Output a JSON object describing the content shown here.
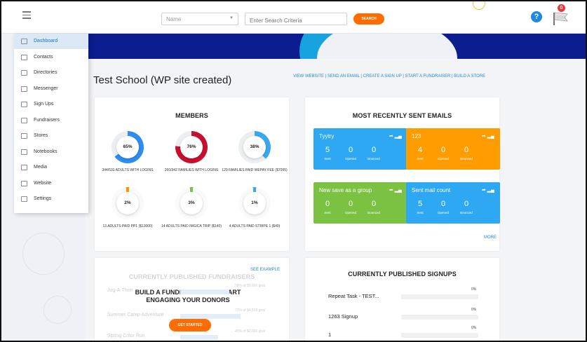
{
  "topbar": {
    "search_select_placeholder": "Name",
    "search_input_placeholder": "Enter Search Criteria",
    "search_button_label": "SEARCH",
    "help_icon_glyph": "?",
    "notification_count": "0"
  },
  "sidebar": {
    "items": [
      {
        "label": "Dashboard",
        "icon": "dashboard-icon"
      },
      {
        "label": "Contacts",
        "icon": "contacts-icon"
      },
      {
        "label": "Directories",
        "icon": "directories-icon"
      },
      {
        "label": "Messenger",
        "icon": "messenger-icon"
      },
      {
        "label": "Sign Ups",
        "icon": "sign-ups-icon"
      },
      {
        "label": "Fundraisers",
        "icon": "fundraisers-icon"
      },
      {
        "label": "Stores",
        "icon": "stores-icon"
      },
      {
        "label": "Notebooks",
        "icon": "notebooks-icon"
      },
      {
        "label": "Media",
        "icon": "media-icon"
      },
      {
        "label": "Website",
        "icon": "website-icon"
      },
      {
        "label": "Settings",
        "icon": "settings-icon"
      }
    ],
    "active_index": 0
  },
  "page": {
    "title": "Test School (WP site created)",
    "quick_links": [
      "VIEW WEBSITE",
      "SEND AN EMAIL",
      "CREATE A SIGN UP",
      "START A FUNDRAISER",
      "BUILD A STORE"
    ]
  },
  "members": {
    "title": "MEMBERS",
    "stats": [
      {
        "percent": "65%",
        "fraction": 0.65,
        "color": "#2f8cf0",
        "label": "344/531 ADULTS WITH LOGINS"
      },
      {
        "percent": "76%",
        "fraction": 0.76,
        "color": "#c8102e",
        "label": "260/342 FAMILIES WITH LOGINS"
      },
      {
        "percent": "38%",
        "fraction": 0.38,
        "color": "#3aa8f0",
        "label": "129 FAMILIES PAID WEPAY FEE ($7095)"
      },
      {
        "percent": "2%",
        "fraction": 0.02,
        "color": "#ff9800",
        "label": "13 ADULTS PAID PP1 ($13000)"
      },
      {
        "percent": "3%",
        "fraction": 0.03,
        "color": "#7cc242",
        "label": "14 ADULTS PAID IMGICA TRIP ($140)"
      },
      {
        "percent": "1%",
        "fraction": 0.01,
        "color": "#3aa8f0",
        "label": "4 ADULTS PAID STRIPE 1 ($40)"
      }
    ]
  },
  "emails": {
    "title": "MOST RECENTLY SENT EMAILS",
    "more_label": "MORE",
    "stat_labels": [
      "Sent",
      "Opened",
      "Bounced"
    ],
    "tiles": [
      {
        "name": "Tyytry",
        "color": "#2ea8f2",
        "sent": "5",
        "opened": "0",
        "bounced": "0"
      },
      {
        "name": "123",
        "color": "#ff9c00",
        "sent": "4",
        "opened": "0",
        "bounced": "0"
      },
      {
        "name": "New save as a group",
        "color": "#7cc242",
        "sent": "0",
        "opened": "0",
        "bounced": "0"
      },
      {
        "name": "Sent mail count",
        "color": "#2ea8f2",
        "sent": "5",
        "opened": "0",
        "bounced": "0"
      }
    ]
  },
  "fundraisers": {
    "title": "CURRENTLY PUBLISHED FUNDRAISERS",
    "see_example": "SEE EXAMPLE",
    "cta": "BUILD A FUNDRAISER AND START ENGAGING YOUR DONORS",
    "get_started": "GET STARTED",
    "examples": [
      {
        "name": "Jog-A-Thon",
        "goal": "58% of $5,000 goal",
        "fraction": 0.58
      },
      {
        "name": "Summer Camp Adventure",
        "goal": "72% of $4,500 goal",
        "fraction": 0.72
      },
      {
        "name": "Spring Color Run",
        "goal": "45% of $2,000 goal",
        "fraction": 0.45
      }
    ]
  },
  "signups": {
    "title": "CURRENTLY PUBLISHED SIGNUPS",
    "items": [
      {
        "name": "Repeat Task - TEST...",
        "percent": "0%",
        "fraction": 0
      },
      {
        "name": "1263 Signup",
        "percent": "0%",
        "fraction": 0
      },
      {
        "name": "1",
        "percent": "0%",
        "fraction": 0
      }
    ]
  }
}
